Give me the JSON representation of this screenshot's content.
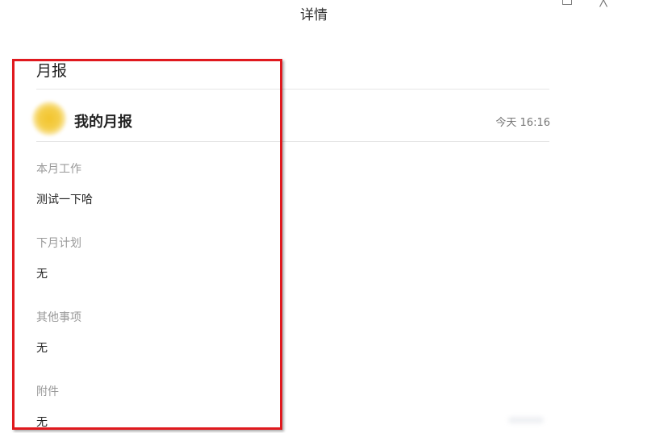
{
  "window": {
    "title": "详情",
    "maximize_icon": "maximize-icon",
    "close_icon": "close-icon",
    "close_glyph": "╳"
  },
  "report": {
    "title": "月报",
    "author": "我的月报",
    "time": "今天 16:16",
    "sections": [
      {
        "label": "本月工作",
        "value": "测试一下哈"
      },
      {
        "label": "下月计划",
        "value": "无"
      },
      {
        "label": "其他事项",
        "value": "无"
      },
      {
        "label": "附件",
        "value": "无"
      }
    ]
  },
  "annotation": {
    "highlight_color": "#e0191e"
  }
}
